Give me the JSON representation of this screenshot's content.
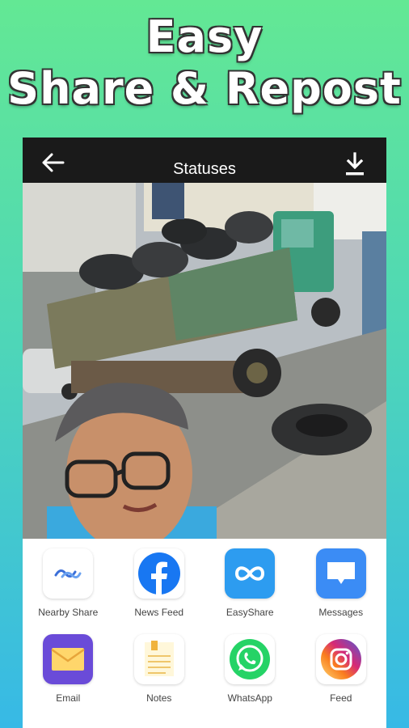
{
  "headline": {
    "line1": "Easy",
    "line2": "Share & Repost"
  },
  "appbar": {
    "title": "Statuses",
    "back_icon": "arrow-left-icon",
    "download_icon": "download-icon"
  },
  "photo": {
    "description_icon": "status-photo"
  },
  "share_sheet": {
    "apps": [
      {
        "label": "Nearby Share",
        "icon": "nearby-share-icon"
      },
      {
        "label": "News Feed",
        "icon": "facebook-icon"
      },
      {
        "label": "EasyShare",
        "icon": "easyshare-icon"
      },
      {
        "label": "Messages",
        "icon": "messages-icon"
      },
      {
        "label": "Email",
        "icon": "email-icon"
      },
      {
        "label": "Notes",
        "icon": "notes-icon"
      },
      {
        "label": "WhatsApp",
        "icon": "whatsapp-icon"
      },
      {
        "label": "Feed",
        "icon": "instagram-icon"
      }
    ]
  },
  "colors": {
    "facebook": "#1877f2",
    "easyshare": "#2d9cf0",
    "messages": "#3b8cf5",
    "email": "#6a4bd8",
    "whatsapp": "#25d366"
  }
}
